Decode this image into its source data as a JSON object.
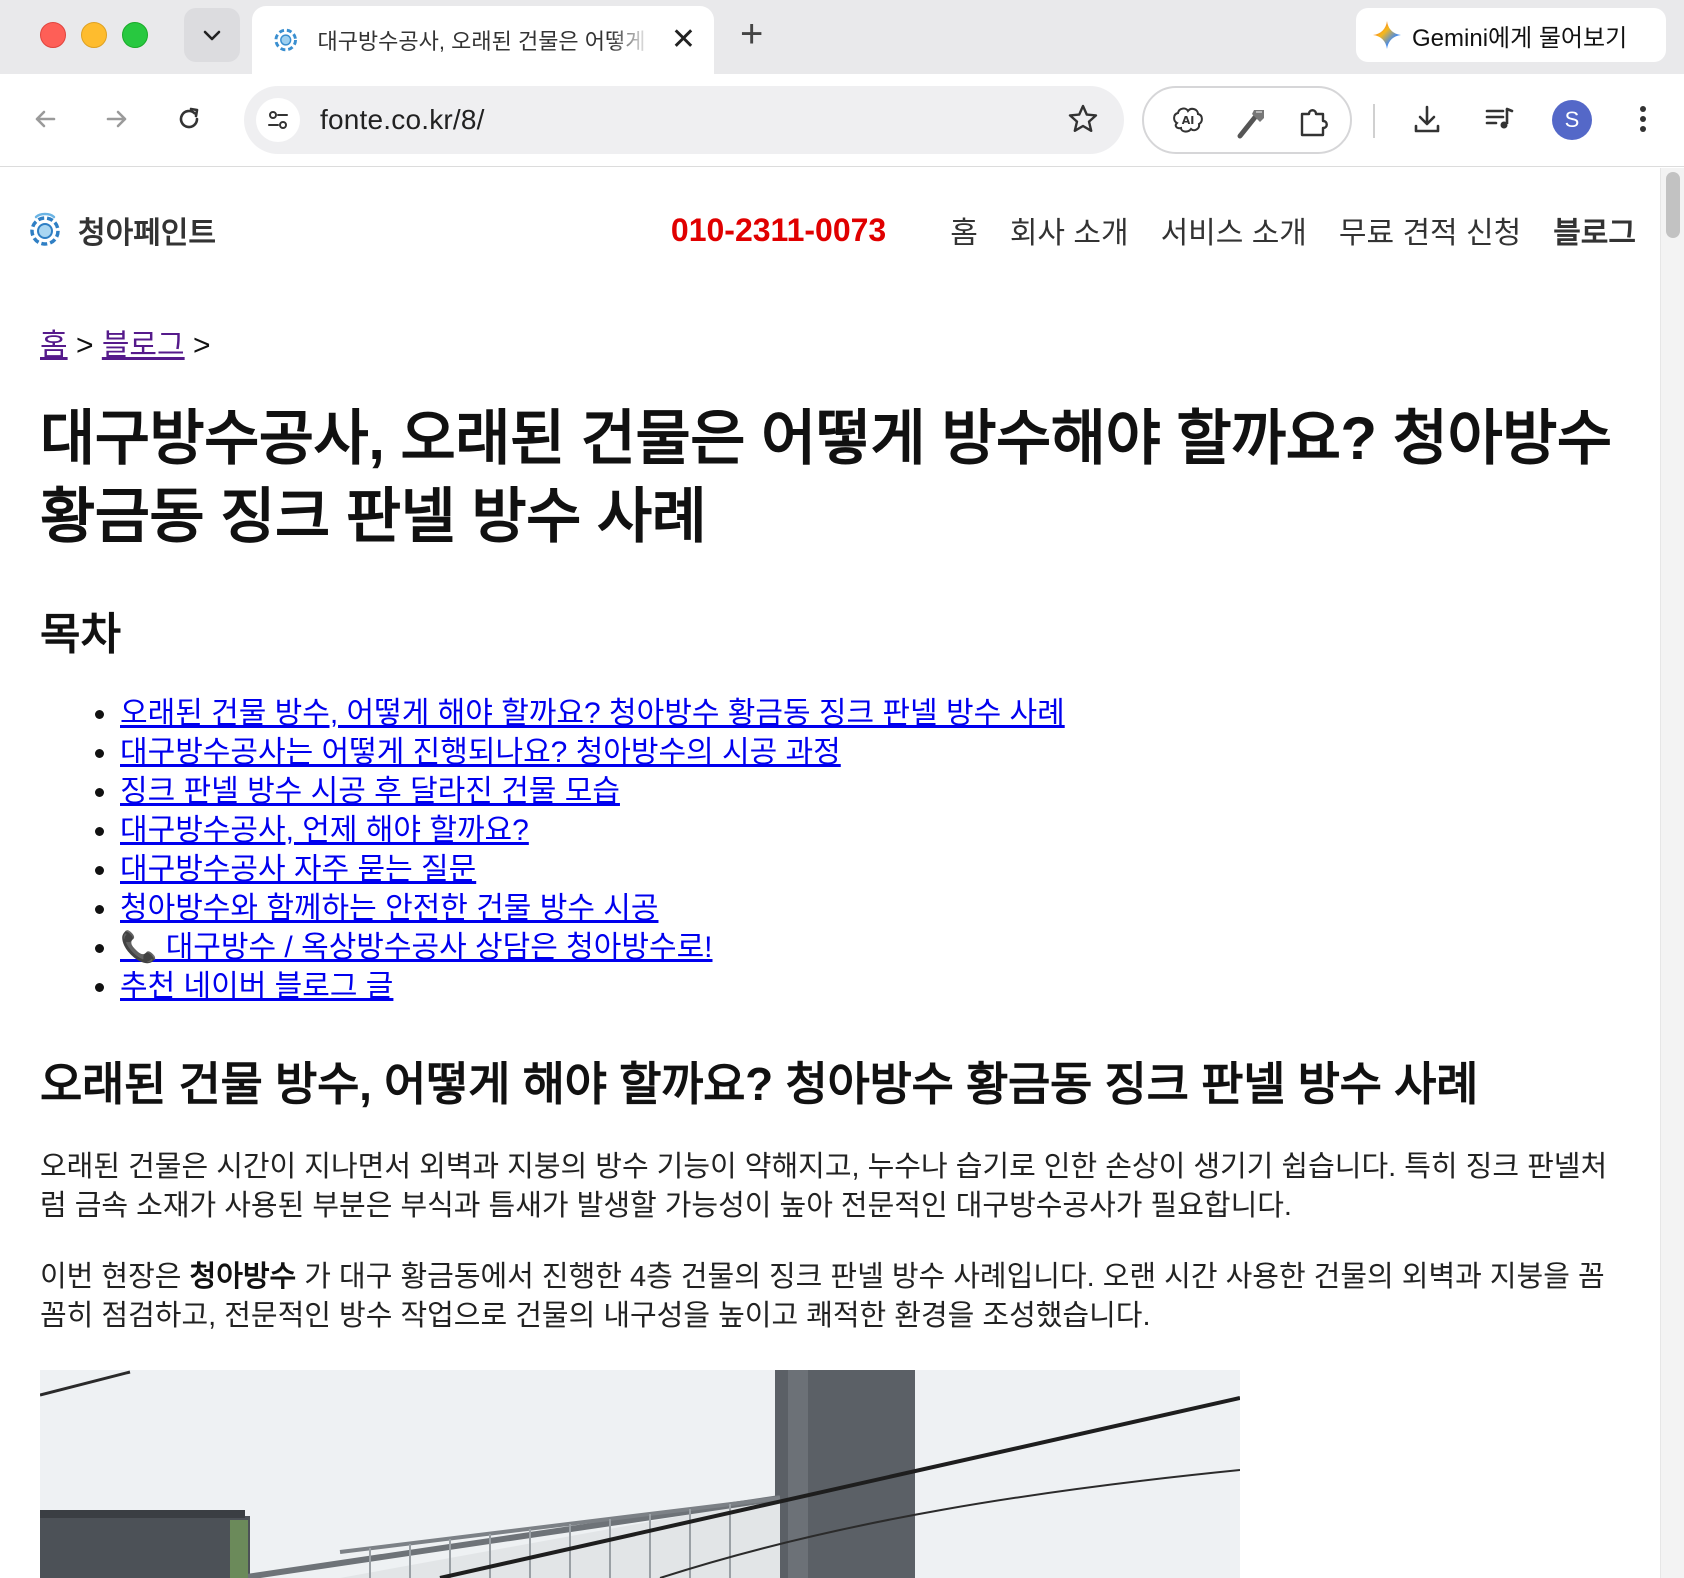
{
  "browser": {
    "tab_title": "대구방수공사, 오래된 건물은 어떻게 방수해야 할까요? 청아방수 황금동 징크 판넬 방수 사례",
    "gemini_label": "Gemini에게 물어보기",
    "url": "fonte.co.kr/8/",
    "avatar_letter": "S"
  },
  "site": {
    "brand": "청아페인트",
    "phone": "010-2311-0073",
    "menu": [
      "홈",
      "회사 소개",
      "서비스 소개",
      "무료 견적 신청",
      "블로그"
    ]
  },
  "breadcrumb": {
    "home": "홈",
    "sep1": ">",
    "blog": "블로그",
    "sep2": ">"
  },
  "post": {
    "title": "대구방수공사, 오래된 건물은 어떻게 방수해야 할까요? 청아방수 황금동 징크 판넬 방수 사례",
    "toc_heading": "목차",
    "toc": [
      "오래된 건물 방수, 어떻게 해야 할까요? 청아방수 황금동 징크 판넬 방수 사례",
      "대구방수공사는 어떻게 진행되나요? 청아방수의 시공 과정",
      "징크 판넬 방수 시공 후 달라진 건물 모습",
      "대구방수공사, 언제 해야 할까요?",
      "대구방수공사 자주 묻는 질문",
      "청아방수와 함께하는 안전한 건물 방수 시공",
      "📞 대구방수 / 옥상방수공사 상담은 청아방수로!",
      "추천 네이버 블로그 글"
    ],
    "section_heading": "오래된 건물 방수, 어떻게 해야 할까요? 청아방수 황금동 징크 판넬 방수 사례",
    "para1": "오래된 건물은 시간이 지나면서 외벽과 지붕의 방수 기능이 약해지고, 누수나 습기로 인한 손상이 생기기 쉽습니다. 특히 징크 판넬처럼 금속 소재가 사용된 부분은 부식과 틈새가 발생할 가능성이 높아 전문적인 대구방수공사가 필요합니다.",
    "para2_prefix": "이번 현장은 ",
    "para2_bold": "청아방수",
    "para2_suffix": " 가 대구 황금동에서 진행한 4층 건물의 징크 판넬 방수 사례입니다. 오랜 시간 사용한 건물의 외벽과 지붕을 꼼꼼히 점검하고, 전문적인 방수 작업으로 건물의 내구성을 높이고 쾌적한 환경을 조성했습니다."
  },
  "colors": {
    "phone": "#e00000",
    "link": "#0000ee",
    "visited_link": "#551a8b",
    "avatar": "#5468c8"
  }
}
